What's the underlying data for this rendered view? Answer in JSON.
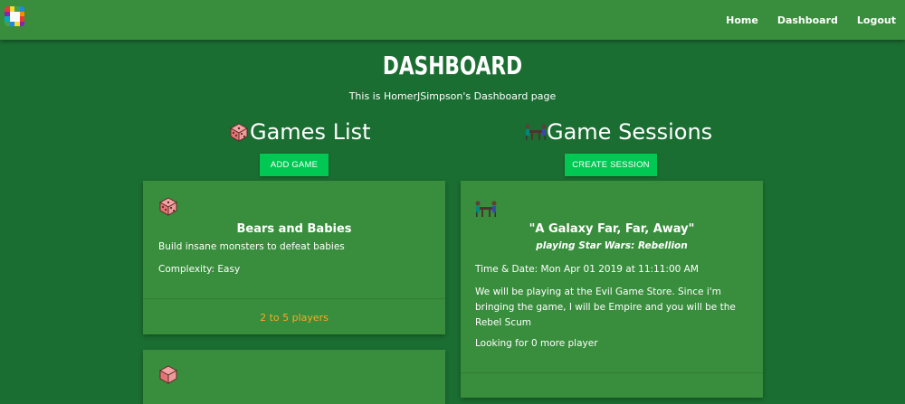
{
  "nav": {
    "links": [
      "Home",
      "Dashboard",
      "Logout"
    ]
  },
  "header": {
    "title": "DASHBOARD",
    "subtitle": "This is HomerJSimpson's Dashboard page"
  },
  "games": {
    "heading": "Games List",
    "add_button": "ADD GAME",
    "icon": "dice-icon",
    "cards": [
      {
        "title": "Bears and Babies",
        "description": "Build insane monsters to defeat babies",
        "complexity": "Complexity: Easy",
        "players": "2 to 5 players"
      }
    ]
  },
  "sessions": {
    "heading": "Game Sessions",
    "create_button": "CREATE SESSION",
    "icon": "game-table-icon",
    "cards": [
      {
        "title": "\"A Galaxy Far, Far, Away\"",
        "playing": "playing Star Wars: Rebellion",
        "datetime": "Time & Date: Mon Apr 01 2019 at 11:11:00 AM",
        "desc_line1": "We will be playing at the Evil Game Store. Since i'm",
        "desc_line2": "bringing the game, I will be Empire and you will be the",
        "desc_line3": "Rebel Scum",
        "looking": "Looking for 0 more player"
      }
    ]
  },
  "colors": {
    "background": "#1b6e32",
    "navbar": "#388e3c",
    "card": "#388e3c",
    "button": "#00c853",
    "players_text": "#ffa726"
  }
}
